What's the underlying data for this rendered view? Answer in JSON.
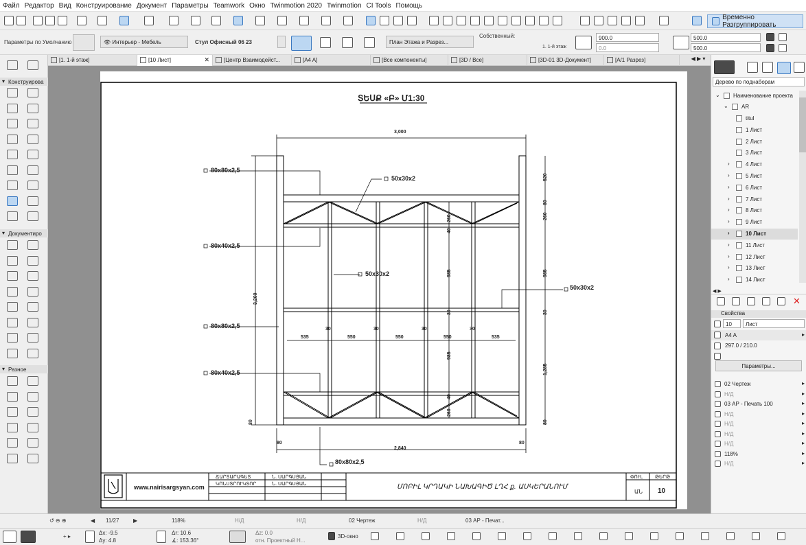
{
  "menu": [
    "Файл",
    "Редактор",
    "Вид",
    "Конструирование",
    "Документ",
    "Параметры",
    "Teamwork",
    "Окно",
    "Twinmotion 2020",
    "Twinmotion",
    "CI Tools",
    "Помощь"
  ],
  "toolbar": {
    "ungroup_label": "Временно Разгруппировать"
  },
  "infobox": {
    "default_params": "Параметры по Умолчанию",
    "layer": "Интерьер - Мебель",
    "object_name": "Стул Офисный 06 23",
    "story_view": "План Этажа и Разрез...",
    "own_label": "Собственный:",
    "floor": "1. 1-й этаж",
    "elev1": "900.0",
    "elev2": "0.0",
    "size1": "500.0",
    "size2": "500.0"
  },
  "tabs": [
    {
      "label": "[1. 1-й этаж]",
      "active": false
    },
    {
      "label": "[10 Лист]",
      "active": true
    },
    {
      "label": "[Центр Взаимодейст...",
      "active": false
    },
    {
      "label": "[A4 A]",
      "active": false
    },
    {
      "label": "[Все компоненты]",
      "active": false
    },
    {
      "label": "[3D / Все]",
      "active": false
    },
    {
      "label": "[3D-01 3D-Документ]",
      "active": false
    },
    {
      "label": "[A/1 Разрез]",
      "active": false
    }
  ],
  "left_palette": {
    "section1": "Конструирова",
    "section2": "Документиро",
    "section3": "Разное"
  },
  "drawing": {
    "title": "ՏԵՍՔ «Բ»  Մ1:30",
    "labels": {
      "p80x80_top": "80x80x2,5",
      "p80x40_top": "80x40x2,5",
      "p80x80_mid": "80x80x2,5",
      "p80x40_bot": "80x40x2,5",
      "p80x80_bot": "80x80x2,5",
      "p50_top": "50x30x2",
      "p50_mid": "50x30x2",
      "p50_right": "50x30x2"
    },
    "dims": {
      "top_width": "3,000",
      "bottom_width": "2,840",
      "left_height": "3,200",
      "bot80_left": "80",
      "bot80_right": "80",
      "left80": "80",
      "r520": "520",
      "r80": "80",
      "r260a": "260",
      "r985a": "985",
      "r30": "30",
      "r1285": "1,285",
      "r80b": "80",
      "c260a": "260",
      "c40a": "40",
      "c985a": "985",
      "c30a": "30",
      "c985b": "985",
      "c40b": "40",
      "c260b": "260",
      "h535a": "535",
      "h30a": "30",
      "h550a": "550",
      "h30b": "30",
      "h550b": "550",
      "h30c": "30",
      "h550c": "550",
      "h30d": "30",
      "h535b": "535"
    },
    "titleblock": {
      "website": "www.nairisargsyan.com",
      "row1_role": "ՃԱՐՏԱՐԱԳԵՏ",
      "row1_name": "Ն. ՍԱՐԳՍՅԱՆ",
      "row2_role": "ԿՈՆՍՏՐՈՒԿՏՈՐ",
      "row2_name": "Ն. ՍԱՐԳՍՅԱՆ",
      "project": "ՄՈԲԻԼ ԿՐԴԱԿԻ ՆԱԽԱԳԻԾ ԼՂՀ ք. ԱՍԿԵՐԱՆՈՒՄ",
      "stage_h": "ՓՈՒԼ",
      "stage_v": "ԱՆ",
      "sheet_h": "ԹԵՐԹ",
      "sheet_v": "10"
    }
  },
  "right_panel": {
    "tree_dropdown": "Дерево по поднаборам",
    "project_name": "Наименование проекта",
    "folder": "AR",
    "items": [
      "titul",
      "1 Лист",
      "2 Лист",
      "3 Лист",
      "4 Лист",
      "5 Лист",
      "6 Лист",
      "7 Лист",
      "8 Лист",
      "9 Лист",
      "10 Лист",
      "11 Лист",
      "12 Лист",
      "13 Лист",
      "14 Лист"
    ],
    "selected_index": 10,
    "properties_header": "Свойства",
    "prop_id": "10",
    "prop_name": "Лист",
    "prop_format": "A4 A",
    "prop_size": "297.0 / 210.0",
    "params_button": "Параметры...",
    "list": [
      "02 Чертеж",
      "Н/Д",
      "03 АР - Печать 100",
      "Н/Д",
      "Н/Д",
      "Н/Д",
      "Н/Д",
      "118%",
      "Н/Д"
    ]
  },
  "statusbar": {
    "page": "11/27",
    "zoom": "118%",
    "nd1": "Н/Д",
    "nd2": "Н/Д",
    "drawing": "02 Чертеж",
    "nd3": "Н/Д",
    "print": "03 АР - Печат...",
    "dx": "Δx: -9.5",
    "dy": "Δy: 4.8",
    "dr": "Δr: 10.6",
    "da": "∡: 153.36°",
    "dz": "Δz: 0.0",
    "ref": "отн. Проектный Н...",
    "view3d": "3D-окно"
  }
}
